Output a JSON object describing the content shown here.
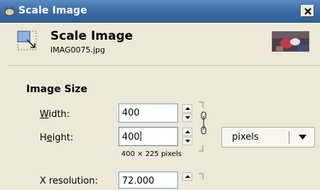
{
  "window": {
    "title": "Scale Image"
  },
  "header": {
    "title": "Scale Image",
    "subtitle": "IMAG0075.jpg",
    "icon": "scale-image-icon"
  },
  "section": {
    "title": "Image Size"
  },
  "width": {
    "label_underlined": "W",
    "label_rest": "idth:",
    "value": "400"
  },
  "height": {
    "label_pre": "H",
    "label_underlined": "e",
    "label_rest": "ight:",
    "value": "400"
  },
  "pixel_note": "400 × 225 pixels",
  "units": {
    "selected": "pixels"
  },
  "xres": {
    "label": "X resolution:",
    "value": "72.000"
  },
  "colors": {
    "titlebar": "#3e6fa8",
    "background": "#ece9d8",
    "field_border": "#7f9db9"
  }
}
